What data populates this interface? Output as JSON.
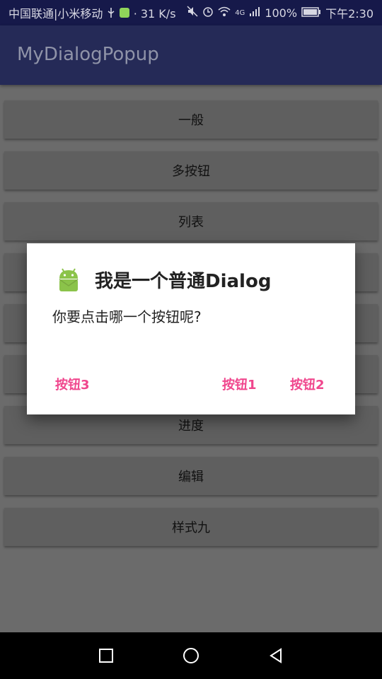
{
  "status_bar": {
    "left_text": "中国联通|小米移动",
    "speed": "· 31 K/s",
    "network": "4G",
    "battery": "100%",
    "time": "下午2:30"
  },
  "app_bar": {
    "title": "MyDialogPopup"
  },
  "buttons": [
    "一般",
    "多按钮",
    "列表",
    "",
    "",
    "",
    "进度",
    "编辑",
    "样式九"
  ],
  "dialog": {
    "title": "我是一个普通Dialog",
    "message": "你要点击哪一个按钮呢?",
    "actions": {
      "neutral": "按钮3",
      "positive_1": "按钮1",
      "positive_2": "按钮2"
    },
    "accent_color": "#f0468d"
  },
  "nav_bar": {
    "icons": [
      "square-icon",
      "circle-icon",
      "back-triangle-icon"
    ]
  }
}
